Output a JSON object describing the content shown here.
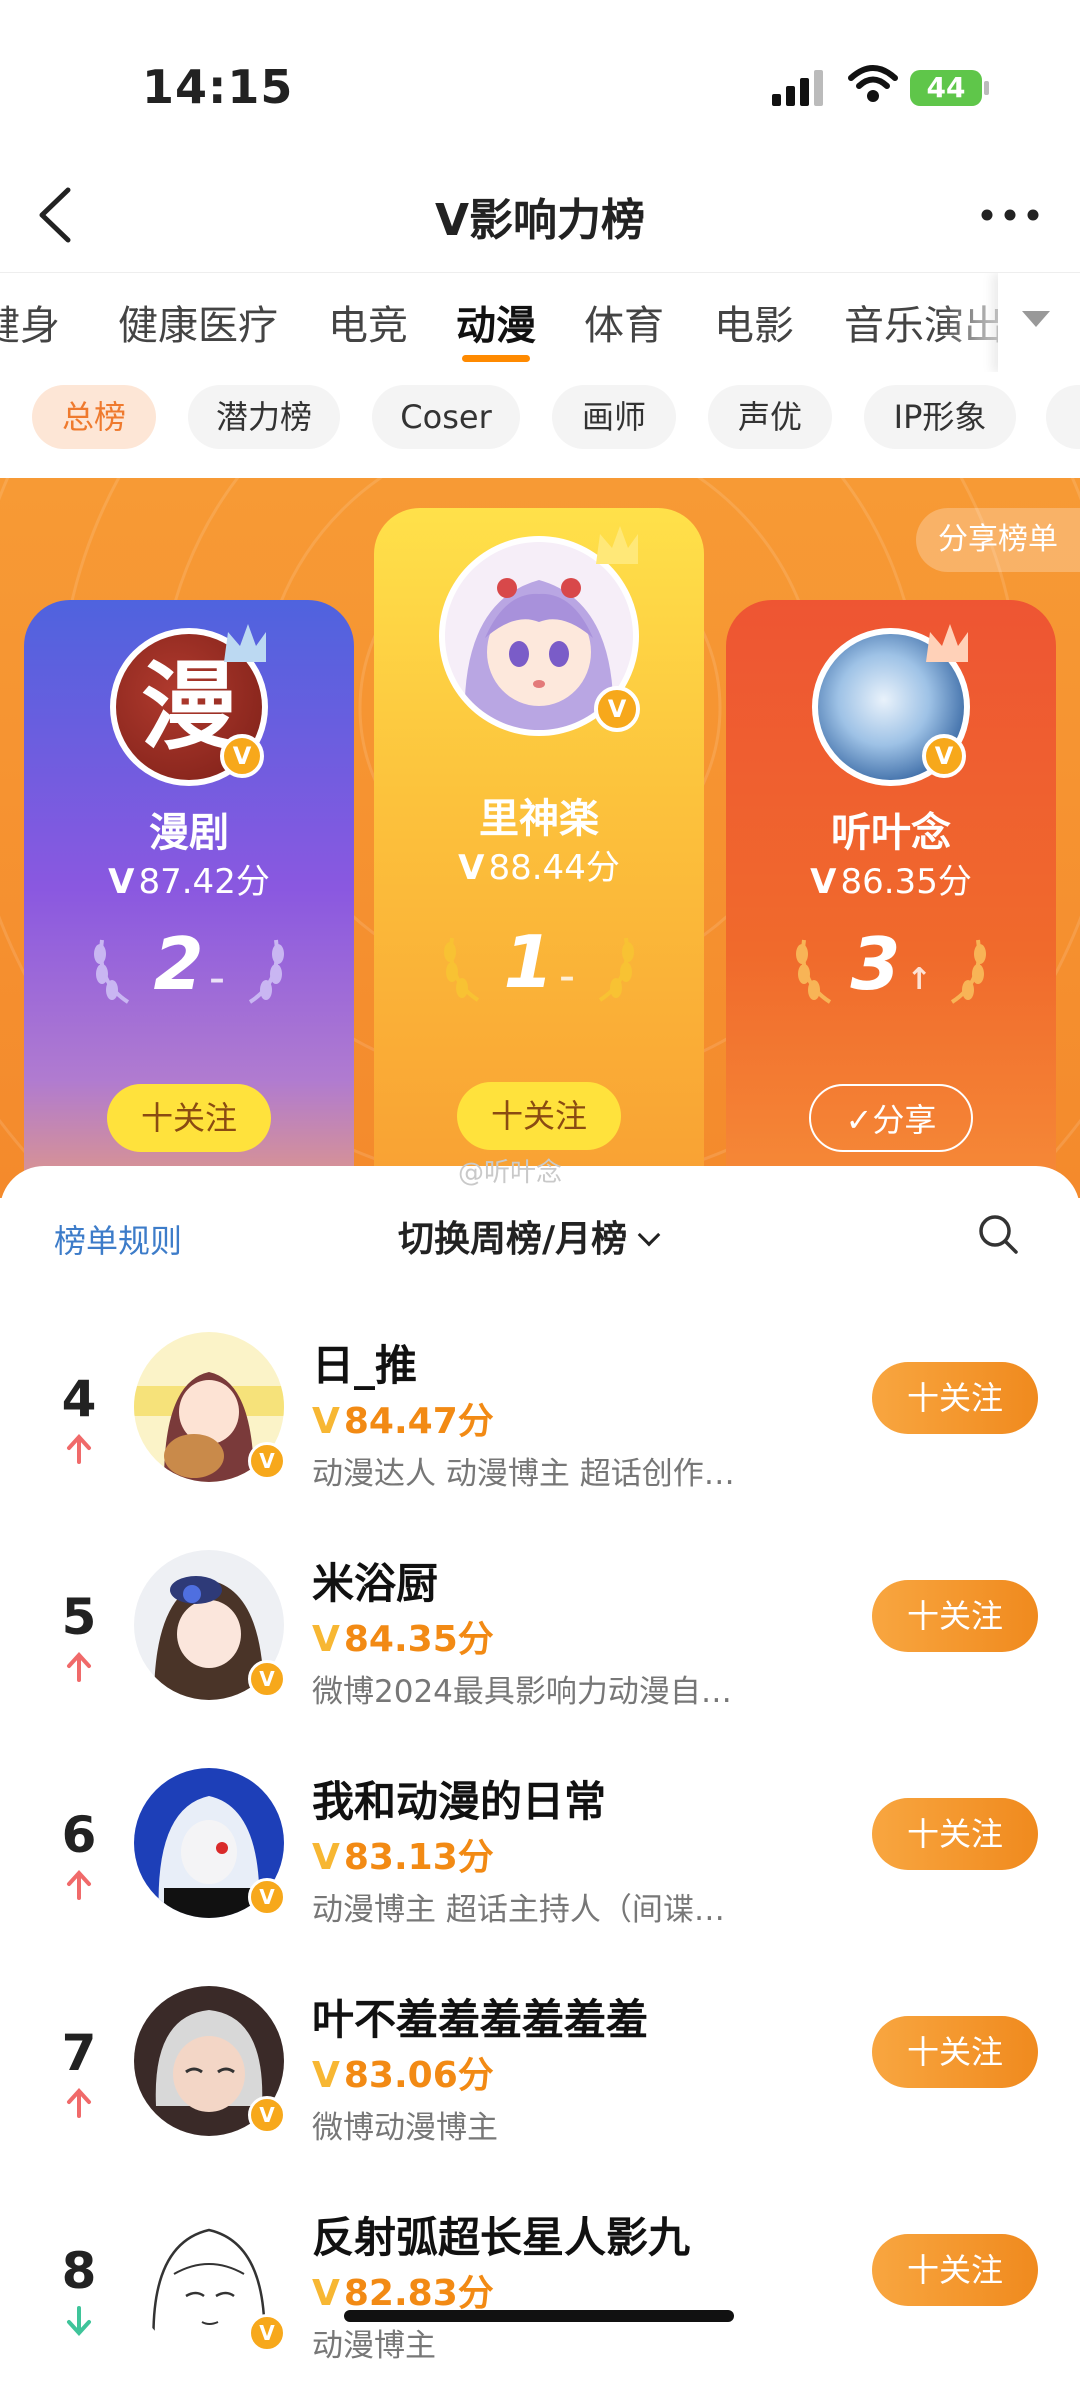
{
  "status": {
    "time": "14:15",
    "battery": "44"
  },
  "nav": {
    "title": "V影响力榜"
  },
  "category_tabs": [
    {
      "label": "健身"
    },
    {
      "label": "健康医疗"
    },
    {
      "label": "电竞"
    },
    {
      "label": "动漫",
      "active": true
    },
    {
      "label": "体育"
    },
    {
      "label": "电影"
    },
    {
      "label": "音乐演出"
    }
  ],
  "sub_tabs": [
    {
      "label": "总榜",
      "active": true
    },
    {
      "label": "潜力榜"
    },
    {
      "label": "Coser"
    },
    {
      "label": "画师"
    },
    {
      "label": "声优"
    },
    {
      "label": "IP形象"
    }
  ],
  "podium": {
    "share_board": "分享榜单",
    "second": {
      "name": "漫剧",
      "score_prefix": "V",
      "score": "87.42分",
      "rank": "2",
      "trend": "–",
      "button": "十关注",
      "avatar_char": "漫"
    },
    "first": {
      "name": "里神楽",
      "score_prefix": "V",
      "score": "88.44分",
      "rank": "1",
      "trend": "–",
      "button": "十关注"
    },
    "third": {
      "name": "听叶念",
      "score_prefix": "V",
      "score": "86.35分",
      "rank": "3",
      "trend": "↑",
      "button": "✓分享"
    }
  },
  "sheet": {
    "watermark": "@听叶念",
    "rules": "榜单规则",
    "switch": "切换周榜/月榜"
  },
  "rows": [
    {
      "rank": "4",
      "trend": "up",
      "name": "日_推",
      "score": "84.47分",
      "desc": "动漫达人 动漫博主 超话创作…",
      "button": "十关注"
    },
    {
      "rank": "5",
      "trend": "up",
      "name": "米浴厨",
      "score": "84.35分",
      "desc": "微博2024最具影响力动漫自…",
      "button": "十关注"
    },
    {
      "rank": "6",
      "trend": "up",
      "name": "我和动漫的日常",
      "score": "83.13分",
      "desc": "动漫博主 超话主持人（间谍…",
      "button": "十关注"
    },
    {
      "rank": "7",
      "trend": "up",
      "name": "叶不羞羞羞羞羞羞",
      "score": "83.06分",
      "desc": "微博动漫博主",
      "button": "十关注"
    },
    {
      "rank": "8",
      "trend": "down",
      "name": "反射弧超长星人影九",
      "score": "82.83分",
      "desc": "动漫博主",
      "button": "十关注"
    }
  ],
  "colors": {
    "accent": "#f28a14",
    "link": "#3d7cc9",
    "up": "#f06a6a",
    "down": "#3fc49a"
  }
}
